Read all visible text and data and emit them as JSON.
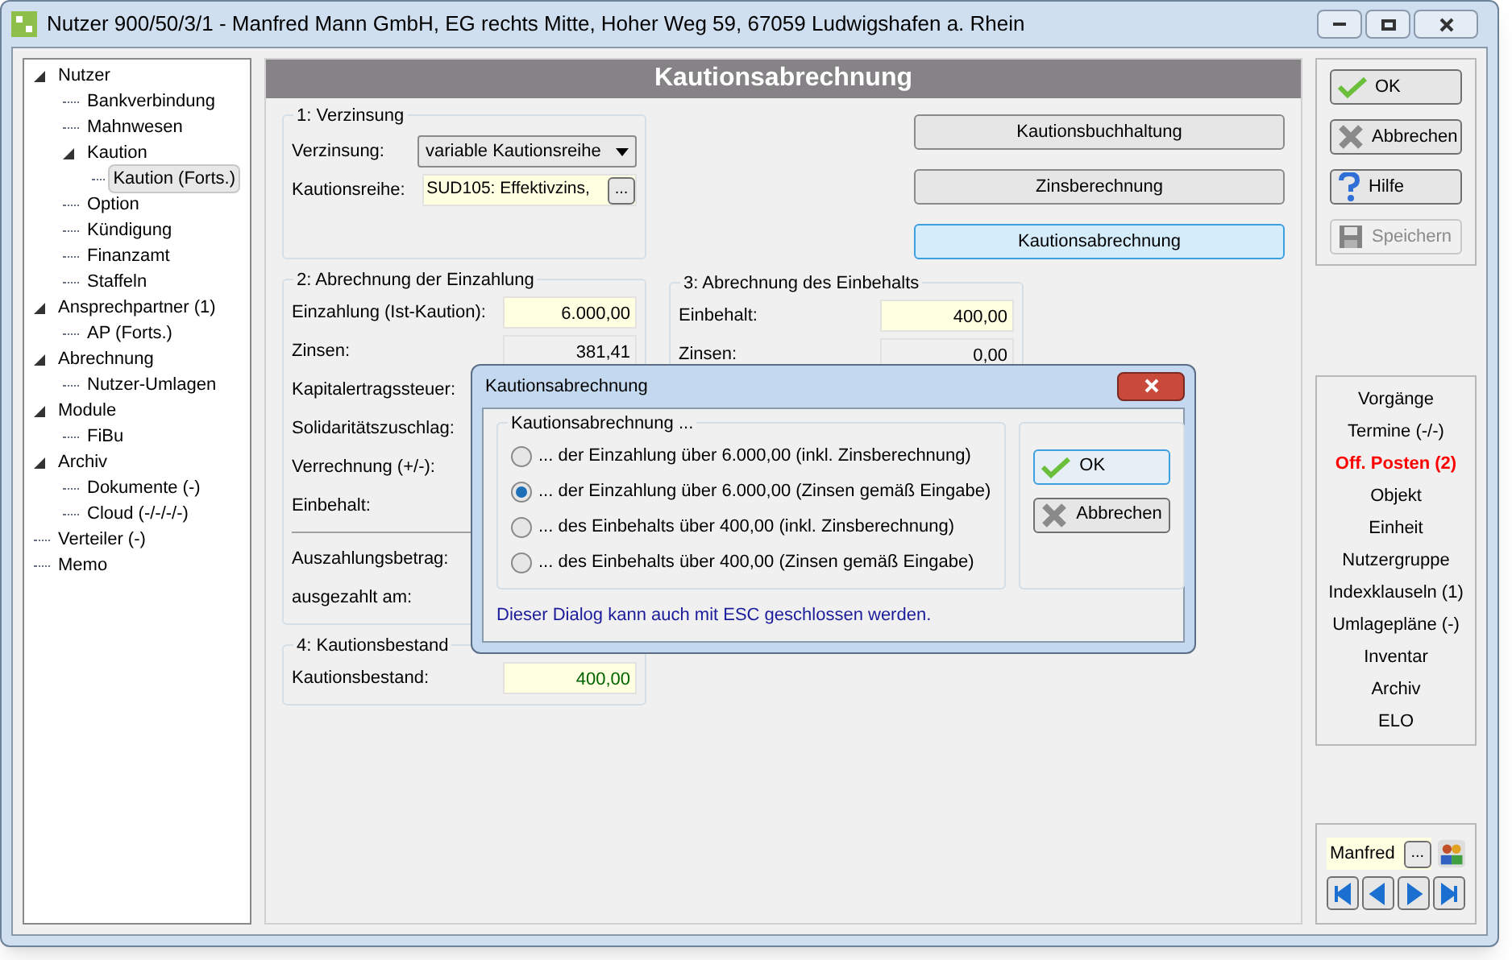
{
  "window": {
    "title": "Nutzer 900/50/3/1 - Manfred Mann GmbH, EG rechts Mitte, Hoher Weg 59, 67059 Ludwigshafen a. Rhein"
  },
  "tree": [
    {
      "label": "Nutzer",
      "expanded": true,
      "selected": false,
      "children": [
        {
          "label": "Bankverbindung",
          "selected": false
        },
        {
          "label": "Mahnwesen",
          "selected": false
        },
        {
          "label": "Kaution",
          "expanded": true,
          "selected": false,
          "children": [
            {
              "label": "Kaution (Forts.)",
              "selected": true
            }
          ]
        },
        {
          "label": "Option",
          "selected": false
        },
        {
          "label": "Kündigung",
          "selected": false
        },
        {
          "label": "Finanzamt",
          "selected": false
        },
        {
          "label": "Staffeln",
          "selected": false
        }
      ]
    },
    {
      "label": "Ansprechpartner (1)",
      "expanded": true,
      "selected": false,
      "children": [
        {
          "label": "AP (Forts.)",
          "selected": false
        }
      ]
    },
    {
      "label": "Abrechnung",
      "expanded": true,
      "selected": false,
      "children": [
        {
          "label": "Nutzer-Umlagen",
          "selected": false
        }
      ]
    },
    {
      "label": "Module",
      "expanded": true,
      "selected": false,
      "children": [
        {
          "label": "FiBu",
          "selected": false
        }
      ]
    },
    {
      "label": "Archiv",
      "expanded": true,
      "selected": false,
      "children": [
        {
          "label": "Dokumente (-)",
          "selected": false
        },
        {
          "label": "Cloud (-/-/-/-)",
          "selected": false
        }
      ]
    },
    {
      "label": "Verteiler (-)",
      "selected": false
    },
    {
      "label": "Memo",
      "selected": false
    }
  ],
  "panel": {
    "title": "Kautionsabrechnung",
    "verzinsung": {
      "legend": "1: Verzinsung",
      "mode_label": "Verzinsung:",
      "mode_value": "variable Kautionsreihe",
      "series_label": "Kautionsreihe:",
      "series_value": "SUD105: Effektivzins,",
      "browse": "..."
    },
    "actions": [
      {
        "label": "Kautionsbuchhaltung",
        "selected": false
      },
      {
        "label": "Zinsberechnung",
        "selected": false
      },
      {
        "label": "Kautionsabrechnung",
        "selected": true
      }
    ],
    "einzahlung": {
      "legend": "2: Abrechnung der Einzahlung",
      "rows": [
        {
          "label": "Einzahlung (Ist-Kaution):",
          "value": "6.000,00",
          "kind": "input"
        },
        {
          "label": "Zinsen:",
          "value": "381,41",
          "kind": "readonly"
        },
        {
          "label": "Kapitalertragssteuer:",
          "kind": "label"
        },
        {
          "label": "Solidaritätszuschlag:",
          "kind": "label"
        },
        {
          "label": "Verrechnung (+/-):",
          "kind": "label"
        },
        {
          "label": "Einbehalt:",
          "kind": "label"
        },
        {
          "kind": "rule"
        },
        {
          "label": "Auszahlungsbetrag:",
          "kind": "label"
        },
        {
          "label": "ausgezahlt am:",
          "kind": "label"
        }
      ]
    },
    "einbehalt": {
      "legend": "3: Abrechnung des Einbehalts",
      "rows": [
        {
          "label": "Einbehalt:",
          "value": "400,00",
          "kind": "input"
        },
        {
          "label": "Zinsen:",
          "value": "0,00",
          "kind": "readonly"
        }
      ]
    },
    "bestand": {
      "legend": "4: Kautionsbestand",
      "label": "Kautionsbestand:",
      "value": "400,00"
    }
  },
  "buttons": [
    {
      "label": "OK",
      "disabled": false
    },
    {
      "label": "Abbrechen",
      "disabled": false
    },
    {
      "label": "Hilfe",
      "disabled": false
    },
    {
      "label": "Speichern",
      "disabled": true
    }
  ],
  "links": [
    {
      "label": "Vorgänge",
      "alert": false
    },
    {
      "label": "Termine (-/-)",
      "alert": false
    },
    {
      "label": "Off. Posten (2)",
      "alert": true
    },
    {
      "label": "Objekt",
      "alert": false
    },
    {
      "label": "Einheit",
      "alert": false
    },
    {
      "label": "Nutzergruppe",
      "alert": false
    },
    {
      "label": "Indexklauseln (1)",
      "alert": false
    },
    {
      "label": "Umlagepläne (-)",
      "alert": false
    },
    {
      "label": "Inventar",
      "alert": false
    },
    {
      "label": "Archiv",
      "alert": false
    },
    {
      "label": "ELO",
      "alert": false
    }
  ],
  "navigator": {
    "user": "Manfred",
    "browse": "..."
  },
  "dialog": {
    "title": "Kautionsabrechnung",
    "group": "Kautionsabrechnung ...",
    "options": [
      {
        "label": "... der Einzahlung über 6.000,00 (inkl. Zinsberechnung)",
        "selected": false
      },
      {
        "label": "... der Einzahlung über 6.000,00 (Zinsen gemäß Eingabe)",
        "selected": true
      },
      {
        "label": "... des Einbehalts über 400,00 (inkl. Zinsberechnung)",
        "selected": false
      },
      {
        "label": "... des Einbehalts über 400,00 (Zinsen gemäß Eingabe)",
        "selected": false
      }
    ],
    "buttons": [
      {
        "label": "OK",
        "focused": true
      },
      {
        "label": "Abbrechen",
        "focused": false
      }
    ],
    "hint": "Dieser Dialog kann auch mit ESC geschlossen werden."
  }
}
